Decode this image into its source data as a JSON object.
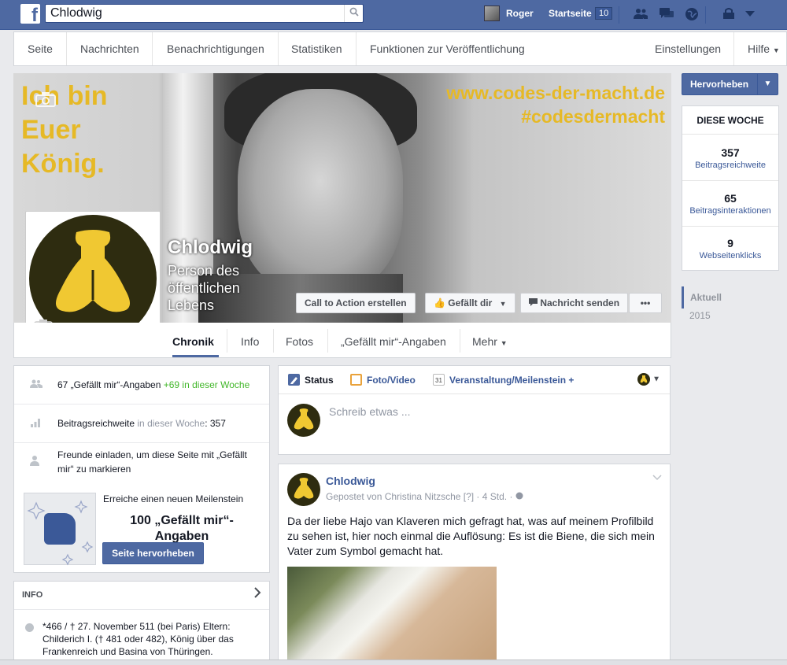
{
  "topbar": {
    "logo": "f",
    "search_value": "Chlodwig",
    "user_name": "Roger",
    "home_label": "Startseite",
    "home_count": "10",
    "icons": [
      "friends-icon",
      "messages-icon",
      "globe-icon",
      "privacy-icon",
      "menu-caret-icon"
    ]
  },
  "admin_nav": {
    "items": [
      "Seite",
      "Nachrichten",
      "Benachrichtigungen",
      "Statistiken",
      "Funktionen zur Veröffentlichung"
    ],
    "settings": "Einstellungen",
    "help": "Hilfe"
  },
  "cover": {
    "text_left_lines": [
      "Ich bin",
      "Euer",
      "König."
    ],
    "text_right_lines": [
      "www.codes-der-macht.de",
      "#codesdermacht"
    ],
    "page_name": "Chlodwig",
    "category": "Person des öffentlichen Lebens",
    "buttons": {
      "cta": "Call to Action erstellen",
      "like": "Gefällt dir",
      "message": "Nachricht senden",
      "more": "•••"
    }
  },
  "tabs": [
    "Chronik",
    "Info",
    "Fotos",
    "„Gefällt mir“-Angaben",
    "Mehr"
  ],
  "right": {
    "promote": "Hervorheben",
    "week_title": "DIESE WOCHE",
    "stats": [
      {
        "value": "357",
        "label": "Beitragsreichweite"
      },
      {
        "value": "65",
        "label": "Beitragsinteraktionen"
      },
      {
        "value": "9",
        "label": "Webseitenklicks"
      }
    ],
    "years": [
      "Aktuell",
      "2015"
    ]
  },
  "left": {
    "likes_text": "67 „Gefällt mir“-Angaben",
    "likes_week": "+69 in dieser Woche",
    "reach_label": "Beitragsreichweite",
    "reach_week": "in dieser Woche",
    "reach_value": ": 357",
    "invite_text": "Freunde einladen, um diese Seite mit „Gefällt mir“ zu markieren",
    "milestone_title": "Erreiche einen neuen Meilenstein",
    "milestone_big": "100 „Gefällt mir“-Angaben",
    "milestone_button": "Seite hervorheben",
    "info_title": "INFO",
    "info_text": "*466 / † 27. November 511 (bei Paris) Eltern: Childerich I. († 481 oder 482), König über das Frankenreich und Basina von Thüringen."
  },
  "composer": {
    "tab_status": "Status",
    "tab_photo": "Foto/Video",
    "tab_event": "Veranstaltung/Meilenstein +",
    "placeholder": "Schreib etwas ...",
    "calendar_day": "31"
  },
  "post": {
    "author": "Chlodwig",
    "meta": "Gepostet von Christina Nitzsche [?] · 4 Std. ·",
    "text": "Da der liebe Hajo van Klaveren mich gefragt hat, was auf meinem Profilbild zu sehen ist, hier noch einmal die Auflösung: Es ist die Biene, die sich mein Vater zum Symbol gemacht hat."
  },
  "colors": {
    "brand_blue": "#4e69a2",
    "cover_yellow": "#e6b926",
    "bee_yellow": "#f0c832",
    "bee_bg": "#2e2c10",
    "positive_green": "#42b72a"
  }
}
